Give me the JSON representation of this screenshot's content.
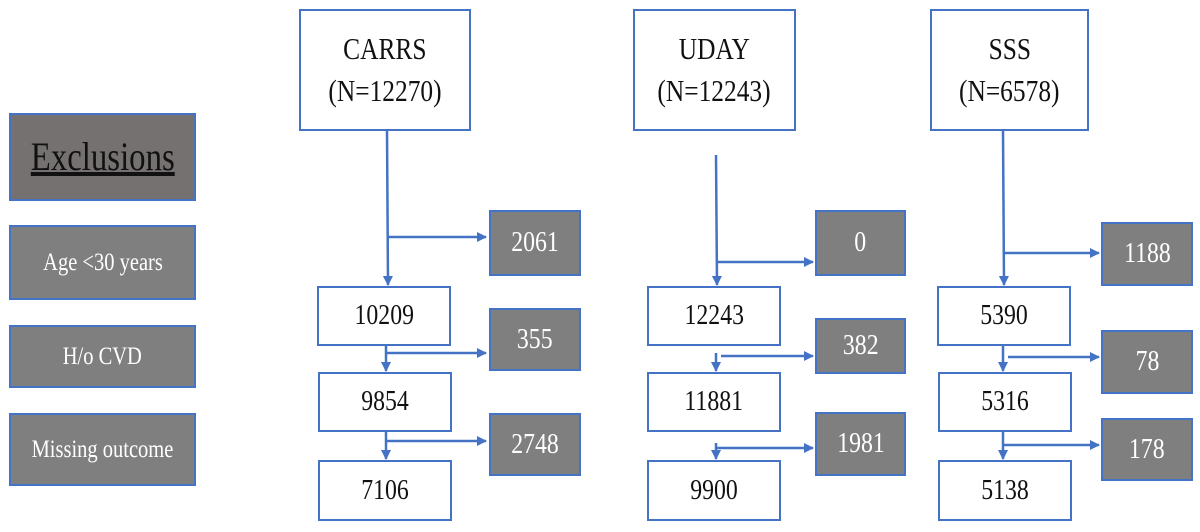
{
  "colors": {
    "border": "#4472c4",
    "exclusion_box": "#7f7f7f",
    "header_box": "#767171",
    "arrow": "#4472c4"
  },
  "legend": {
    "title": "Exclusions",
    "items": [
      "Age <30 years",
      "H/o CVD",
      "Missing outcome"
    ]
  },
  "cohorts": [
    {
      "name": "CARRS",
      "n": "(N=12270)",
      "remaining": [
        "10209",
        "9854",
        "7106"
      ],
      "excluded": [
        "2061",
        "355",
        "2748"
      ]
    },
    {
      "name": "UDAY",
      "n": "(N=12243)",
      "remaining": [
        "12243",
        "11881",
        "9900"
      ],
      "excluded": [
        "0",
        "382",
        "1981"
      ]
    },
    {
      "name": "SSS",
      "n": "(N=6578)",
      "remaining": [
        "5390",
        "5316",
        "5138"
      ],
      "excluded": [
        "1188",
        "78",
        "178"
      ]
    }
  ]
}
